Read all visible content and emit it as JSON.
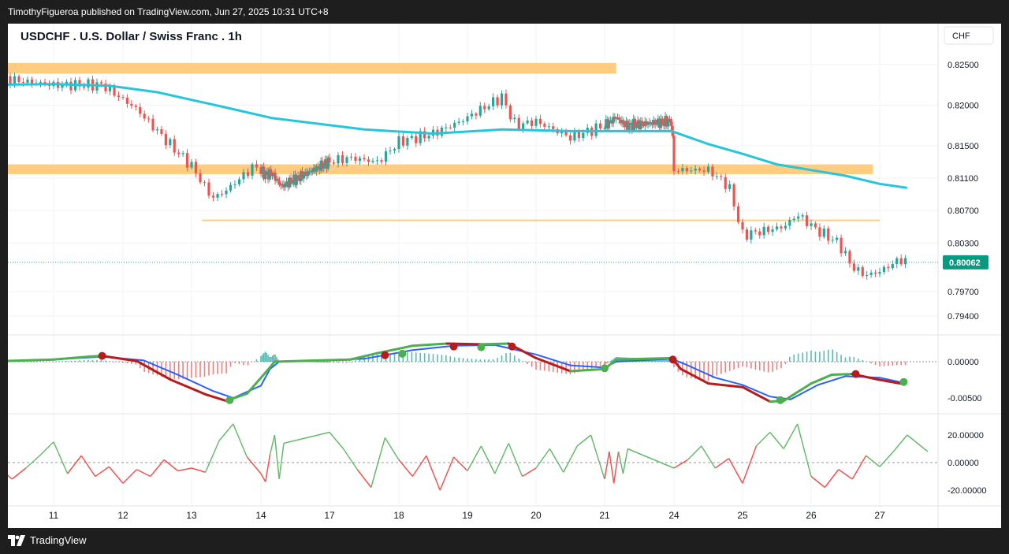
{
  "header": {
    "published": "TimothyFigueroa published on TradingView.com, Jun 27, 2025 10:31 UTC+8"
  },
  "footer": {
    "brand": "TradingView"
  },
  "chart_data": [
    {
      "type": "candlestick",
      "title": "USDCHF . U.S. Dollar / Swiss Franc . 1h",
      "currency": "CHF",
      "last_price": "0.80062",
      "price_ticks": [
        "0.82500",
        "0.82000",
        "0.81500",
        "0.81100",
        "0.80700",
        "0.80300",
        "0.79700",
        "0.79400"
      ],
      "x_tick_labels": [
        "11",
        "12",
        "13",
        "14",
        "17",
        "18",
        "19",
        "20",
        "21",
        "24",
        "25",
        "26",
        "27"
      ],
      "close_path": [
        [
          10,
          0.8235
        ],
        [
          11,
          0.8225
        ],
        [
          11.7,
          0.8225
        ],
        [
          12.2,
          0.8195
        ],
        [
          12.7,
          0.815
        ],
        [
          13.0,
          0.8125
        ],
        [
          13.3,
          0.8085
        ],
        [
          13.5,
          0.8095
        ],
        [
          13.9,
          0.8125
        ],
        [
          14.1,
          0.8115
        ],
        [
          14.5,
          0.8115
        ],
        [
          14.9,
          0.81
        ],
        [
          17.3,
          0.8135
        ],
        [
          17.7,
          0.813
        ],
        [
          18.0,
          0.8155
        ],
        [
          18.5,
          0.8165
        ],
        [
          18.9,
          0.818
        ],
        [
          19.3,
          0.82
        ],
        [
          19.5,
          0.821
        ],
        [
          19.7,
          0.8175
        ],
        [
          20.0,
          0.818
        ],
        [
          20.5,
          0.816
        ],
        [
          21.0,
          0.8175
        ],
        [
          21.5,
          0.8185
        ],
        [
          21.9,
          0.8175
        ],
        [
          23.9,
          0.818
        ],
        [
          24.0,
          0.812
        ],
        [
          24.5,
          0.812
        ],
        [
          24.8,
          0.81
        ],
        [
          25.0,
          0.804
        ],
        [
          25.3,
          0.8045
        ],
        [
          25.6,
          0.805
        ],
        [
          25.8,
          0.8065
        ],
        [
          26.1,
          0.8045
        ],
        [
          26.4,
          0.803
        ],
        [
          26.6,
          0.8
        ],
        [
          26.8,
          0.799
        ],
        [
          27.0,
          0.7995
        ],
        [
          27.3,
          0.801
        ],
        [
          27.4,
          0.8006
        ]
      ],
      "moving_average": {
        "color": "#26c6da",
        "values": [
          [
            10,
            0.8225
          ],
          [
            11,
            0.8226
          ],
          [
            11.8,
            0.8224
          ],
          [
            12.5,
            0.8216
          ],
          [
            13.5,
            0.8197
          ],
          [
            14.5,
            0.8184
          ],
          [
            17.5,
            0.817
          ],
          [
            18.5,
            0.8165
          ],
          [
            19.5,
            0.817
          ],
          [
            20.5,
            0.8168
          ],
          [
            21.5,
            0.8168
          ],
          [
            23.9,
            0.8168
          ],
          [
            24.5,
            0.8152
          ],
          [
            25.0,
            0.814
          ],
          [
            25.5,
            0.8127
          ],
          [
            26.0,
            0.812
          ],
          [
            26.5,
            0.8113
          ],
          [
            27.0,
            0.8103
          ],
          [
            27.4,
            0.8098
          ]
        ]
      },
      "zones": [
        {
          "from_x": 10,
          "to_x": 21.5,
          "y_low": 0.8239,
          "y_high": 0.8252,
          "color": "#ffcc80"
        },
        {
          "from_x": 10,
          "to_x": 26.9,
          "y_low": 0.8115,
          "y_high": 0.8127,
          "color": "#ffcc80"
        }
      ],
      "lines": [
        {
          "from_x": 13.15,
          "to_x": 27.0,
          "y": 0.8058,
          "color": "#ffcc80"
        },
        {
          "from_x": 10,
          "to_x": 28.0,
          "y": 0.80062,
          "color": "#26a69a",
          "style": "dotted"
        }
      ]
    },
    {
      "type": "macd",
      "y_ticks": [
        "0.00000",
        "-0.00500"
      ],
      "line_color_up": "#4caf50",
      "line_color_down": "#b71c1c",
      "signal_color": "#2962ff",
      "macd": [
        [
          10,
          0.0
        ],
        [
          11,
          0.0003
        ],
        [
          11.5,
          0.0007
        ],
        [
          11.7,
          0.0008
        ],
        [
          12.2,
          0.0001
        ],
        [
          12.7,
          -0.0025
        ],
        [
          13.2,
          -0.0045
        ],
        [
          13.5,
          -0.0054
        ],
        [
          13.8,
          -0.0044
        ],
        [
          14.2,
          -0.0015
        ],
        [
          14.6,
          0.0
        ],
        [
          17.3,
          0.0003
        ],
        [
          17.7,
          0.0012
        ],
        [
          18.2,
          0.0022
        ],
        [
          18.7,
          0.0025
        ],
        [
          19.2,
          0.0024
        ],
        [
          19.6,
          0.0025
        ],
        [
          20.0,
          0.0005
        ],
        [
          20.5,
          -0.0013
        ],
        [
          21.0,
          -0.001
        ],
        [
          21.5,
          0.0003
        ],
        [
          23.9,
          0.0005
        ],
        [
          24.1,
          -0.001
        ],
        [
          24.5,
          -0.003
        ],
        [
          25.0,
          -0.0035
        ],
        [
          25.4,
          -0.0055
        ],
        [
          25.6,
          -0.0054
        ],
        [
          26.0,
          -0.003
        ],
        [
          26.3,
          -0.0018
        ],
        [
          26.6,
          -0.0017
        ],
        [
          27.0,
          -0.0025
        ],
        [
          27.3,
          -0.003
        ]
      ],
      "signal": [
        [
          10,
          0.0
        ],
        [
          11,
          0.0003
        ],
        [
          11.7,
          0.0007
        ],
        [
          12.3,
          0.0002
        ],
        [
          12.8,
          -0.0018
        ],
        [
          13.3,
          -0.004
        ],
        [
          13.6,
          -0.005
        ],
        [
          14.0,
          -0.0033
        ],
        [
          14.4,
          -0.001
        ],
        [
          14.8,
          0.0
        ],
        [
          17.5,
          0.0004
        ],
        [
          18.2,
          0.0016
        ],
        [
          18.8,
          0.0022
        ],
        [
          19.4,
          0.0023
        ],
        [
          20.0,
          0.001
        ],
        [
          20.5,
          -0.0005
        ],
        [
          21.0,
          -0.0008
        ],
        [
          21.5,
          0.0
        ],
        [
          23.9,
          0.0004
        ],
        [
          24.2,
          -0.0005
        ],
        [
          24.6,
          -0.0022
        ],
        [
          25.0,
          -0.0032
        ],
        [
          25.4,
          -0.0048
        ],
        [
          25.7,
          -0.0052
        ],
        [
          26.1,
          -0.0032
        ],
        [
          26.5,
          -0.002
        ],
        [
          27.0,
          -0.0022
        ],
        [
          27.3,
          -0.0028
        ]
      ],
      "cross_markers": [
        {
          "x": 11.7,
          "y": 0.0008,
          "dir": "down"
        },
        {
          "x": 13.55,
          "y": -0.0053,
          "dir": "up"
        },
        {
          "x": 17.8,
          "y": 0.0009,
          "dir": "down"
        },
        {
          "x": 18.05,
          "y": 0.0011,
          "dir": "up"
        },
        {
          "x": 18.8,
          "y": 0.0021,
          "dir": "down"
        },
        {
          "x": 19.2,
          "y": 0.002,
          "dir": "up"
        },
        {
          "x": 19.65,
          "y": 0.0021,
          "dir": "down"
        },
        {
          "x": 21.0,
          "y": -0.0009,
          "dir": "up"
        },
        {
          "x": 23.95,
          "y": 0.0003,
          "dir": "down"
        },
        {
          "x": 25.55,
          "y": -0.0053,
          "dir": "up"
        },
        {
          "x": 26.65,
          "y": -0.0017,
          "dir": "down"
        },
        {
          "x": 27.35,
          "y": -0.0028,
          "dir": "up"
        }
      ]
    },
    {
      "type": "line",
      "y_ticks": [
        "20.00000",
        "0.00000",
        "-20.00000"
      ],
      "color_positive": "#66bb6a",
      "color_negative": "#ef5350",
      "values": [
        [
          10.0,
          8
        ],
        [
          10.2,
          -3
        ],
        [
          10.4,
          -12
        ],
        [
          10.6,
          -4
        ],
        [
          10.8,
          5
        ],
        [
          11.0,
          15
        ],
        [
          11.2,
          -8
        ],
        [
          11.4,
          5
        ],
        [
          11.6,
          -10
        ],
        [
          11.8,
          -3
        ],
        [
          12.0,
          -15
        ],
        [
          12.2,
          -5
        ],
        [
          12.4,
          -10
        ],
        [
          12.6,
          2
        ],
        [
          12.8,
          -6
        ],
        [
          13.0,
          -4
        ],
        [
          13.2,
          -7
        ],
        [
          13.4,
          16
        ],
        [
          13.6,
          28
        ],
        [
          13.8,
          4
        ],
        [
          14.0,
          -8
        ],
        [
          14.2,
          -14
        ],
        [
          14.4,
          6
        ],
        [
          14.6,
          20
        ],
        [
          14.8,
          -12
        ],
        [
          15.0,
          14
        ],
        [
          17.0,
          22
        ],
        [
          17.2,
          10
        ],
        [
          17.4,
          -5
        ],
        [
          17.6,
          -18
        ],
        [
          17.8,
          18
        ],
        [
          18.0,
          2
        ],
        [
          18.2,
          -10
        ],
        [
          18.4,
          5
        ],
        [
          18.6,
          -20
        ],
        [
          18.8,
          4
        ],
        [
          19.0,
          -6
        ],
        [
          19.2,
          12
        ],
        [
          19.4,
          -8
        ],
        [
          19.6,
          14
        ],
        [
          19.8,
          -10
        ],
        [
          20.0,
          -4
        ],
        [
          20.2,
          10
        ],
        [
          20.4,
          -7
        ],
        [
          20.6,
          12
        ],
        [
          20.8,
          20
        ],
        [
          21.0,
          -12
        ],
        [
          21.2,
          8
        ],
        [
          21.4,
          -15
        ],
        [
          21.6,
          8
        ],
        [
          21.8,
          -8
        ],
        [
          22.0,
          10
        ],
        [
          24.0,
          -4
        ],
        [
          24.2,
          2
        ],
        [
          24.4,
          12
        ],
        [
          24.6,
          -4
        ],
        [
          24.8,
          3
        ],
        [
          25.0,
          -15
        ],
        [
          25.2,
          12
        ],
        [
          25.4,
          22
        ],
        [
          25.6,
          10
        ],
        [
          25.8,
          28
        ],
        [
          26.0,
          -10
        ],
        [
          26.2,
          -18
        ],
        [
          26.4,
          -5
        ],
        [
          26.6,
          -12
        ],
        [
          26.8,
          5
        ],
        [
          27.0,
          -3
        ],
        [
          27.2,
          8
        ],
        [
          27.4,
          20
        ],
        [
          27.6,
          12
        ],
        [
          27.7,
          8
        ]
      ]
    }
  ]
}
